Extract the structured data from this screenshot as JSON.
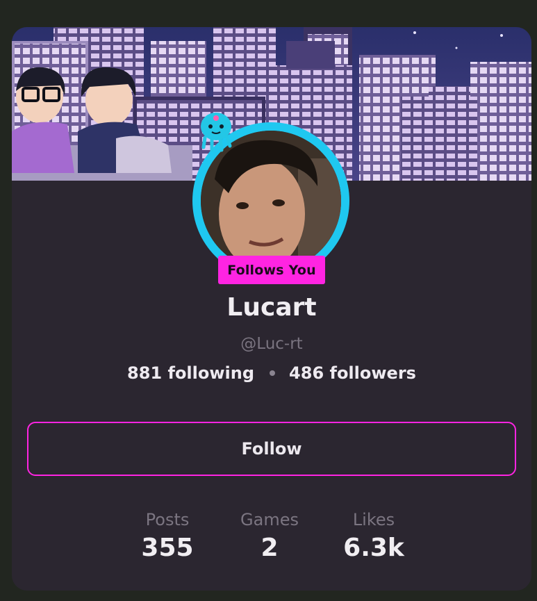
{
  "profile": {
    "display_name": "Lucart",
    "handle": "@Luc-rt",
    "follows_you_badge": "Follows You",
    "following_text": "881 following",
    "followers_text": "486 followers"
  },
  "actions": {
    "follow_label": "Follow"
  },
  "stats": [
    {
      "label": "Posts",
      "value": "355"
    },
    {
      "label": "Games",
      "value": "2"
    },
    {
      "label": "Likes",
      "value": "6.3k"
    }
  ],
  "colors": {
    "accent": "#ff24e2",
    "avatar_ring": "#1fc8f0",
    "card_background": "#2b2630",
    "page_background": "#222620"
  }
}
